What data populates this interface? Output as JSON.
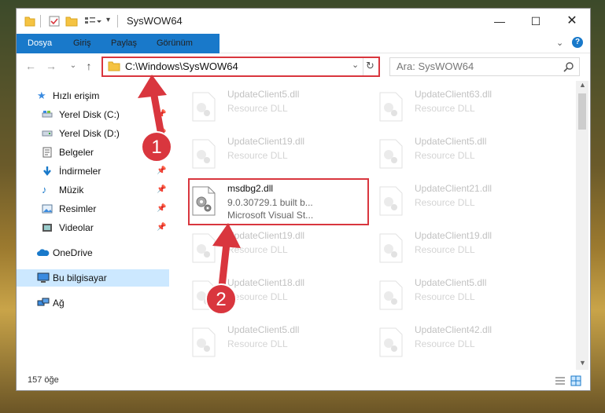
{
  "window": {
    "title": "SysWOW64"
  },
  "ribbon": {
    "tabs": [
      "Dosya",
      "Giriş",
      "Paylaş",
      "Görünüm"
    ]
  },
  "address": {
    "path": "C:\\Windows\\SysWOW64"
  },
  "search": {
    "placeholder": "Ara: SysWOW64"
  },
  "sidebar": {
    "items": [
      {
        "label": "Hızlı erişim",
        "icon": "star-icon",
        "pinned": false
      },
      {
        "label": "Yerel Disk (C:)",
        "icon": "drive-icon",
        "pinned": true
      },
      {
        "label": "Yerel Disk (D:)",
        "icon": "drive-icon",
        "pinned": true
      },
      {
        "label": "Belgeler",
        "icon": "documents-icon",
        "pinned": true
      },
      {
        "label": "İndirmeler",
        "icon": "download-icon",
        "pinned": true
      },
      {
        "label": "Müzik",
        "icon": "music-icon",
        "pinned": true
      },
      {
        "label": "Resimler",
        "icon": "pictures-icon",
        "pinned": true
      },
      {
        "label": "Videolar",
        "icon": "video-icon",
        "pinned": true
      },
      {
        "label": "OneDrive",
        "icon": "cloud-icon",
        "pinned": false
      },
      {
        "label": "Bu bilgisayar",
        "icon": "computer-icon",
        "pinned": false
      },
      {
        "label": "Ağ",
        "icon": "network-icon",
        "pinned": false
      }
    ]
  },
  "files": {
    "left": [
      {
        "name": "UpdateClient5.dll",
        "desc": "Resource DLL"
      },
      {
        "name": "UpdateClient19.dll",
        "desc": "Resource DLL"
      },
      {
        "name": "msdbg2.dll",
        "desc": "9.0.30729.1 built b...",
        "sub": "Microsoft Visual St..."
      },
      {
        "name": "UpdateClient19.dll",
        "desc": "Resource DLL"
      },
      {
        "name": "UpdateClient18.dll",
        "desc": "Resource DLL"
      },
      {
        "name": "UpdateClient5.dll",
        "desc": "Resource DLL"
      }
    ],
    "right": [
      {
        "name": "UpdateClient63.dll",
        "desc": "Resource DLL"
      },
      {
        "name": "UpdateClient5.dll",
        "desc": "Resource DLL"
      },
      {
        "name": "UpdateClient21.dll",
        "desc": "Resource DLL"
      },
      {
        "name": "UpdateClient19.dll",
        "desc": "Resource DLL"
      },
      {
        "name": "UpdateClient5.dll",
        "desc": "Resource DLL"
      },
      {
        "name": "UpdateClient42.dll",
        "desc": "Resource DLL"
      }
    ]
  },
  "status": {
    "count": "157 öğe"
  },
  "annotations": {
    "step1": "1",
    "step2": "2",
    "color": "#d9363e"
  }
}
